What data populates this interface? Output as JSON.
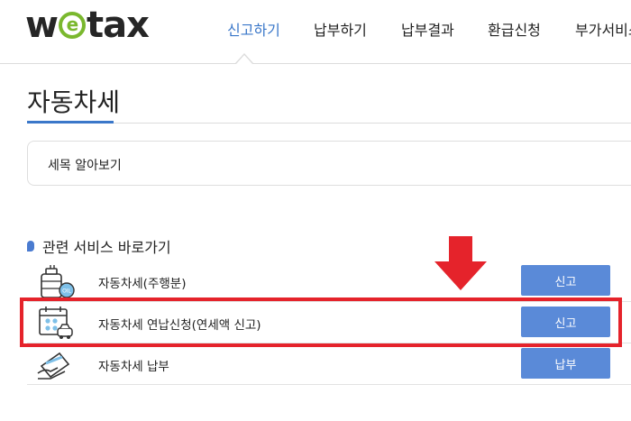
{
  "header": {
    "logo": {
      "prefix": "w",
      "e": "e",
      "suffix": "tax"
    },
    "nav": [
      {
        "label": "신고하기",
        "active": true
      },
      {
        "label": "납부하기",
        "active": false
      },
      {
        "label": "납부결과",
        "active": false
      },
      {
        "label": "환급신청",
        "active": false
      },
      {
        "label": "부가서비스",
        "active": false
      }
    ]
  },
  "page": {
    "title": "자동차세",
    "info_box_label": "세목 알아보기"
  },
  "related": {
    "title": "관련 서비스 바로가기",
    "items": [
      {
        "icon": "fuel-tank-icon",
        "label": "자동차세(주행분)",
        "button": "신고"
      },
      {
        "icon": "calendar-car-icon",
        "label": "자동차세 연납신청(연세액 신고)",
        "button": "신고",
        "highlighted": true
      },
      {
        "icon": "card-payment-icon",
        "label": "자동차세 납부",
        "button": "납부"
      }
    ]
  },
  "colors": {
    "accent": "#3a77c9",
    "button": "#5a8ad8",
    "highlight": "#e5232b",
    "logo_e": "#7ab82e"
  }
}
